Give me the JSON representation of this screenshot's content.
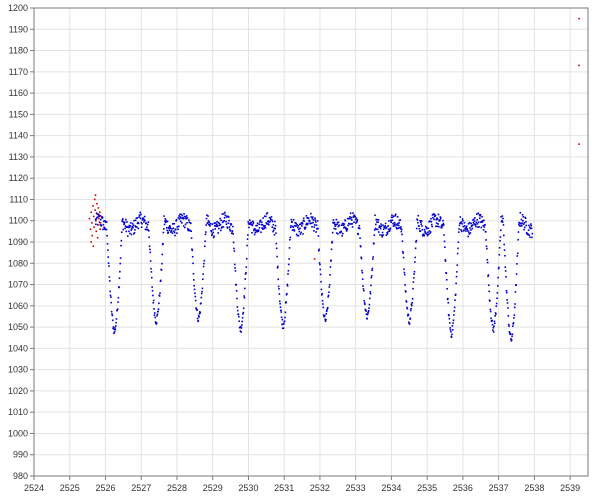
{
  "chart_data": {
    "type": "scatter",
    "title": "",
    "xlabel": "",
    "ylabel": "",
    "xlim": [
      2524,
      2539.5
    ],
    "ylim": [
      980,
      1200
    ],
    "x_ticks": [
      2524,
      2525,
      2526,
      2527,
      2528,
      2529,
      2530,
      2531,
      2532,
      2533,
      2534,
      2535,
      2536,
      2537,
      2538,
      2539
    ],
    "y_ticks": [
      980,
      990,
      1000,
      1010,
      1020,
      1030,
      1040,
      1050,
      1060,
      1070,
      1080,
      1090,
      1100,
      1110,
      1120,
      1130,
      1140,
      1150,
      1160,
      1170,
      1180,
      1190,
      1200
    ],
    "grid": true,
    "legend": "none",
    "series": [
      {
        "color": "#0000cc",
        "marker": "dot",
        "pattern": {
          "x_start": 2525.72,
          "x_end": 2537.95,
          "period": 1.18,
          "max_value": 1100,
          "min_value": 1048,
          "first_minimum_x": 2526.25,
          "minima_x": [
            2526.25,
            2527.42,
            2528.6,
            2529.78,
            2530.97,
            2532.15,
            2533.32,
            2534.5,
            2535.68,
            2536.85,
            2537.35
          ],
          "minima_y": [
            1048,
            1053,
            1054,
            1049,
            1051,
            1053,
            1055,
            1053,
            1047,
            1049,
            1044
          ]
        }
      },
      {
        "color": "#cc0000",
        "marker": "dot",
        "points": [
          [
            2525.55,
            1101
          ],
          [
            2525.58,
            1096
          ],
          [
            2525.6,
            1104
          ],
          [
            2525.62,
            1099
          ],
          [
            2525.63,
            1093
          ],
          [
            2525.65,
            1107
          ],
          [
            2525.67,
            1102
          ],
          [
            2525.68,
            1097
          ],
          [
            2525.7,
            1110
          ],
          [
            2525.71,
            1105
          ],
          [
            2525.73,
            1100
          ],
          [
            2525.74,
            1095
          ],
          [
            2525.76,
            1108
          ],
          [
            2525.77,
            1103
          ],
          [
            2525.79,
            1098
          ],
          [
            2525.8,
            1106
          ],
          [
            2525.82,
            1101
          ],
          [
            2525.84,
            1104
          ],
          [
            2525.86,
            1099
          ],
          [
            2525.88,
            1102
          ],
          [
            2525.6,
            1090
          ],
          [
            2525.66,
            1088
          ],
          [
            2525.72,
            1112
          ],
          [
            2525.78,
            1092
          ],
          [
            2525.85,
            1096
          ],
          [
            2531.85,
            1082
          ],
          [
            2539.25,
            1136
          ],
          [
            2539.25,
            1173
          ],
          [
            2539.25,
            1195
          ]
        ]
      }
    ]
  }
}
